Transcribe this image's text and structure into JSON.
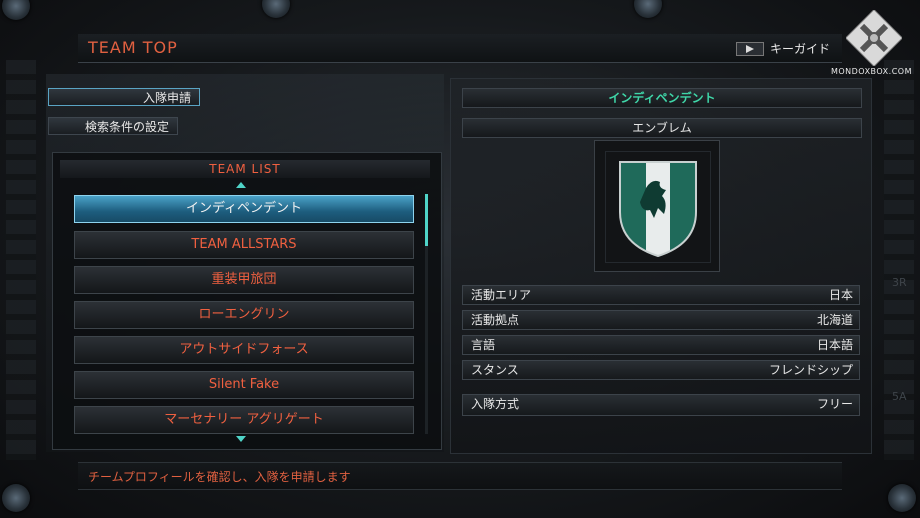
{
  "header": {
    "title": "TEAM TOP",
    "guide_label": "キーガイド"
  },
  "watermark": {
    "text": "MONDOXBOX.COM"
  },
  "left_tabs": [
    {
      "label": "入隊申請"
    },
    {
      "label": "検索条件の設定"
    }
  ],
  "team_list": {
    "title": "TEAM LIST",
    "items": [
      {
        "name": "インディペンデント"
      },
      {
        "name": "TEAM ALLSTARS"
      },
      {
        "name": "重装甲旅団"
      },
      {
        "name": "ローエングリン"
      },
      {
        "name": "アウトサイドフォース"
      },
      {
        "name": "Silent Fake"
      },
      {
        "name": "マーセナリー アグリゲート"
      }
    ],
    "selected_index": 0
  },
  "detail": {
    "team_name": "インディペンデント",
    "emblem_label": "エンブレム",
    "rows": [
      {
        "label": "活動エリア",
        "value": "日本"
      },
      {
        "label": "活動拠点",
        "value": "北海道"
      },
      {
        "label": "言語",
        "value": "日本語"
      },
      {
        "label": "スタンス",
        "value": "フレンドシップ"
      }
    ],
    "join_method": {
      "label": "入隊方式",
      "value": "フリー"
    }
  },
  "footer": {
    "message": "チームプロフィールを確認し、入隊を申請します"
  },
  "side_marks": {
    "right_top": "3R",
    "right_bottom": "5A"
  },
  "colors": {
    "accent_orange": "#f06040",
    "accent_cyan": "#4fd4c8",
    "team_name_green": "#3fd6a8",
    "selection_blue": "#4aa2c8"
  }
}
